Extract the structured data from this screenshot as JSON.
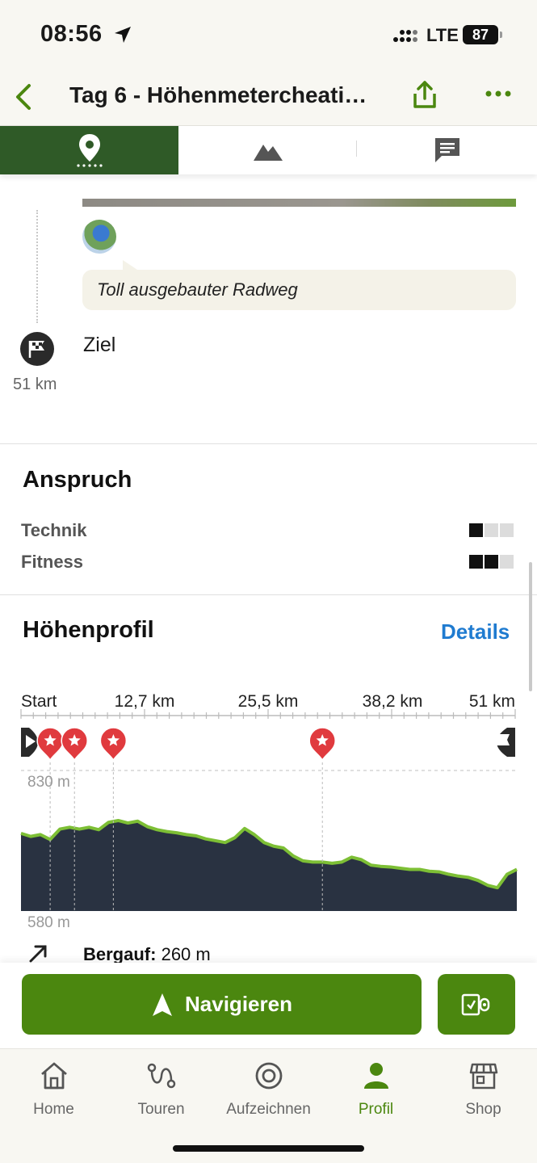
{
  "status_bar": {
    "time": "08:56",
    "network": "LTE",
    "battery": "87"
  },
  "header": {
    "title": "Tag 6 - Höhenmetercheati…"
  },
  "tabs": [
    {
      "name": "map-tab",
      "icon": "location-pin-icon",
      "active": true
    },
    {
      "name": "elevation-tab",
      "icon": "mountain-icon",
      "active": false
    },
    {
      "name": "comments-tab",
      "icon": "chat-icon",
      "active": false
    }
  ],
  "timeline": {
    "comment": "Toll ausgebauter Radweg",
    "goal_label": "Ziel",
    "goal_distance": "51 km"
  },
  "difficulty": {
    "title": "Anspruch",
    "items": [
      {
        "label": "Technik",
        "level": 1,
        "max": 3
      },
      {
        "label": "Fitness",
        "level": 2,
        "max": 3
      }
    ]
  },
  "elevation": {
    "title": "Höhenprofil",
    "details_link": "Details",
    "axis_labels": [
      "Start",
      "12,7 km",
      "25,5 km",
      "38,2 km",
      "51 km"
    ],
    "max_label": "830 m",
    "min_label": "580 m",
    "uphill_label": "Bergauf:",
    "uphill_value": "260 m"
  },
  "chart_data": {
    "type": "area",
    "xlabel": "",
    "ylabel": "",
    "xlim": [
      0,
      51
    ],
    "ylim": [
      580,
      830
    ],
    "x": [
      0,
      1,
      2,
      3,
      4,
      5,
      6,
      7,
      8,
      9,
      10,
      11,
      12,
      13,
      14,
      15,
      16,
      17,
      18,
      19,
      20,
      21,
      22,
      23,
      24,
      25,
      26,
      27,
      28,
      29,
      30,
      31,
      32,
      33,
      34,
      35,
      36,
      37,
      38,
      39,
      40,
      41,
      42,
      43,
      44,
      45,
      46,
      47,
      48,
      49,
      50,
      51
    ],
    "y": [
      727,
      722,
      725,
      717,
      734,
      737,
      734,
      737,
      733,
      745,
      748,
      744,
      747,
      738,
      733,
      730,
      728,
      725,
      723,
      718,
      715,
      712,
      720,
      735,
      725,
      712,
      706,
      703,
      690,
      682,
      680,
      680,
      678,
      680,
      688,
      684,
      675,
      673,
      672,
      670,
      668,
      668,
      665,
      664,
      660,
      657,
      655,
      650,
      642,
      638,
      660,
      668
    ],
    "markers_km": [
      3,
      5.5,
      9.5,
      31
    ]
  },
  "actions": {
    "navigate_label": "Navigieren"
  },
  "bottom_nav": [
    {
      "label": "Home",
      "icon": "home-icon",
      "active": false
    },
    {
      "label": "Touren",
      "icon": "route-icon",
      "active": false
    },
    {
      "label": "Aufzeichnen",
      "icon": "record-icon",
      "active": false
    },
    {
      "label": "Profil",
      "icon": "profile-icon",
      "active": true
    },
    {
      "label": "Shop",
      "icon": "shop-icon",
      "active": false
    }
  ],
  "colors": {
    "brand_green": "#4b870f",
    "tab_active": "#2f5a27",
    "link_blue": "#1f7bd0",
    "marker_red": "#e03a3e"
  }
}
